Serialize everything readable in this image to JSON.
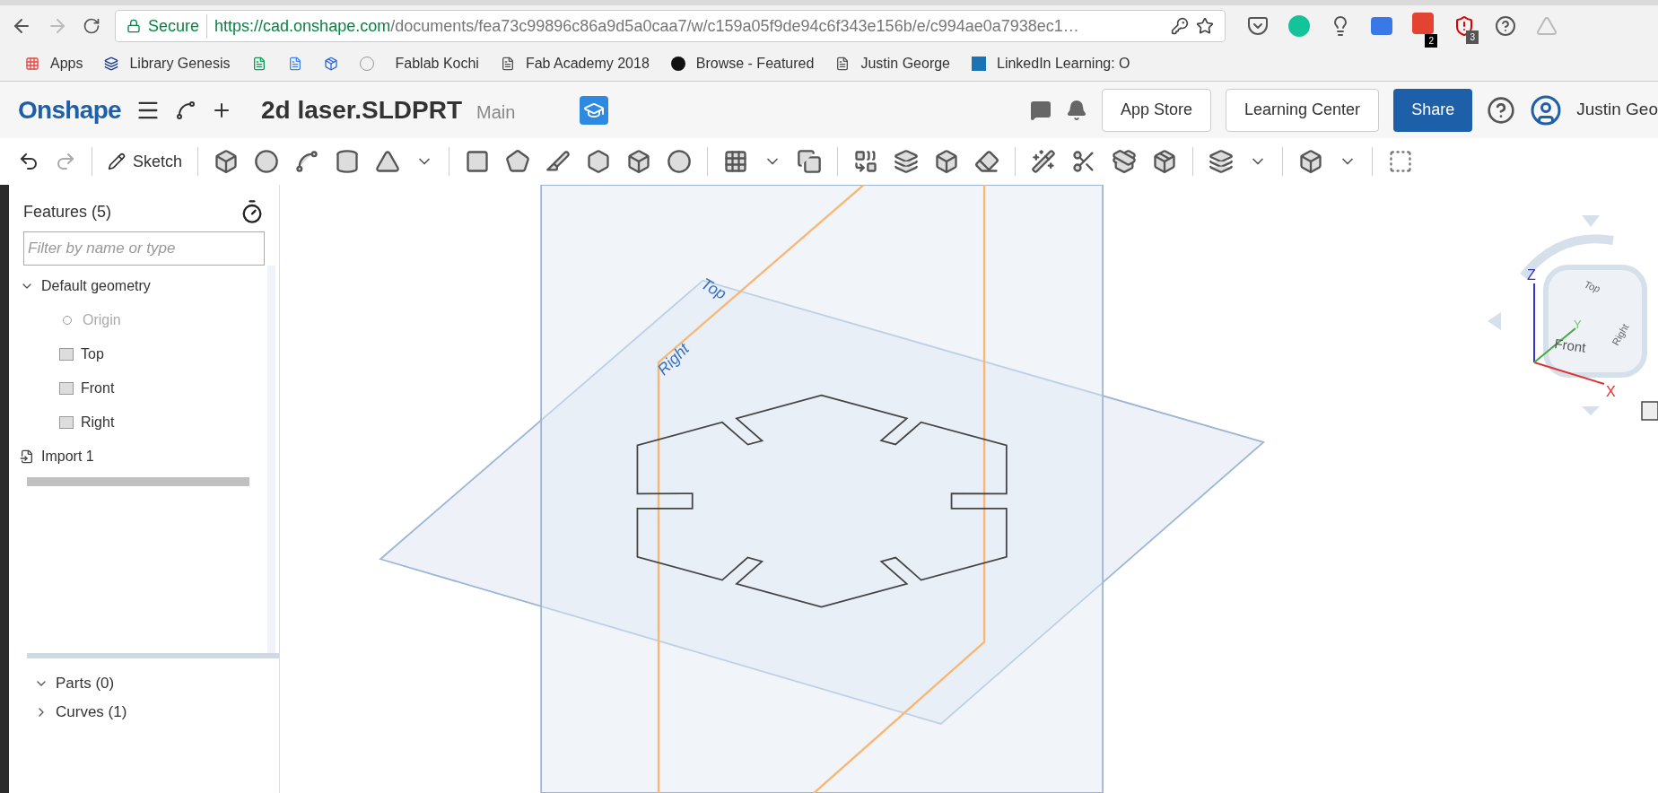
{
  "browser": {
    "secure_label": "Secure",
    "url_host": "https://cad.onshape.com",
    "url_path": "/documents/fea73c99896c86a9d5a0caa7/w/c159a05f9de94c6f343e156b/e/c994ae0a7938ec1…",
    "extension_badges": [
      "2",
      "3"
    ],
    "bookmarks": [
      {
        "kind": "apps",
        "label": "Apps"
      },
      {
        "kind": "book",
        "label": "Library Genesis"
      },
      {
        "kind": "sheets"
      },
      {
        "kind": "docs"
      },
      {
        "kind": "inbox"
      },
      {
        "kind": "k"
      },
      {
        "kind": "none",
        "label": "Fablab Kochi"
      },
      {
        "kind": "page",
        "label": "Fab Academy 2018"
      },
      {
        "kind": "music",
        "label": "Browse - Featured"
      },
      {
        "kind": "page",
        "label": "Justin George"
      },
      {
        "kind": "video",
        "label": "LinkedIn Learning: O"
      }
    ]
  },
  "app": {
    "logo": "Onshape",
    "document_title": "2d laser.SLDPRT",
    "branch": "Main",
    "buttons": [
      "App Store",
      "Learning Center"
    ],
    "share": "Share",
    "user": "Justin Geo"
  },
  "toolbar": {
    "sketch": "Sketch"
  },
  "features": {
    "title": "Features (5)",
    "filter": {
      "placeholder": "Filter by name or type"
    },
    "tree": [
      {
        "kind": "group",
        "label": "Default geometry",
        "expanded": true,
        "children": [
          {
            "kind": "origin",
            "label": "Origin",
            "disabled": true
          },
          {
            "kind": "plane",
            "label": "Top",
            "disabled": false
          },
          {
            "kind": "plane",
            "label": "Front",
            "disabled": false
          },
          {
            "kind": "plane",
            "label": "Right",
            "disabled": false
          }
        ]
      },
      {
        "kind": "import",
        "label": "Import 1"
      }
    ]
  },
  "parts": [
    {
      "label": "Parts (0)",
      "expanded": true
    },
    {
      "label": "Curves (1)",
      "expanded": false
    }
  ],
  "viewport": {
    "plane_labels": [
      "Top",
      "Right"
    ]
  },
  "view_cube": {
    "top": "Top",
    "front": "Front",
    "right": "Right",
    "x": "X",
    "y": "Y",
    "z": "Z"
  }
}
